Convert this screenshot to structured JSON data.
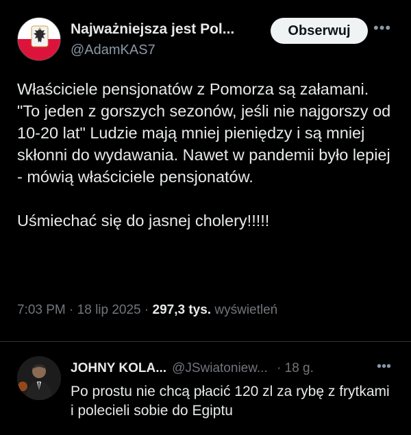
{
  "post": {
    "author_name": "Najważniejsza jest Pol...",
    "author_handle": "@AdamKAS7",
    "follow_label": "Obserwuj",
    "more_label": "•••",
    "text": "Właściciele pensjonatów z Pomorza są załamani. \"To jeden z gorszych sezonów, jeśli nie najgorszy od 10-20 lat\" Ludzie mają mniej pieniędzy i są mniej skłonni do wydawania. Nawet w pandemii było lepiej - mówią właściciele pensjonatów.\n\nUśmiechać się do jasnej cholery!!!!!",
    "time": "7:03 PM",
    "date": "18 lip 2025",
    "views_count": "297,3 tys.",
    "views_label": "wyświetleń",
    "separator": " · "
  },
  "reply": {
    "author_name": "JOHNY KOLA...",
    "author_handle": "@JSwiatoniew...",
    "time": "· 18 g.",
    "more_label": "•••",
    "text": "Po prostu nie chcą płacić 120 zl za rybę z frytkami i polecieli sobie do Egiptu"
  },
  "colors": {
    "background": "#000000",
    "text": "#e7e9ea",
    "secondary_text": "#71767b",
    "follow_button_bg": "#eff3f4",
    "flag_red": "#dc143c"
  }
}
